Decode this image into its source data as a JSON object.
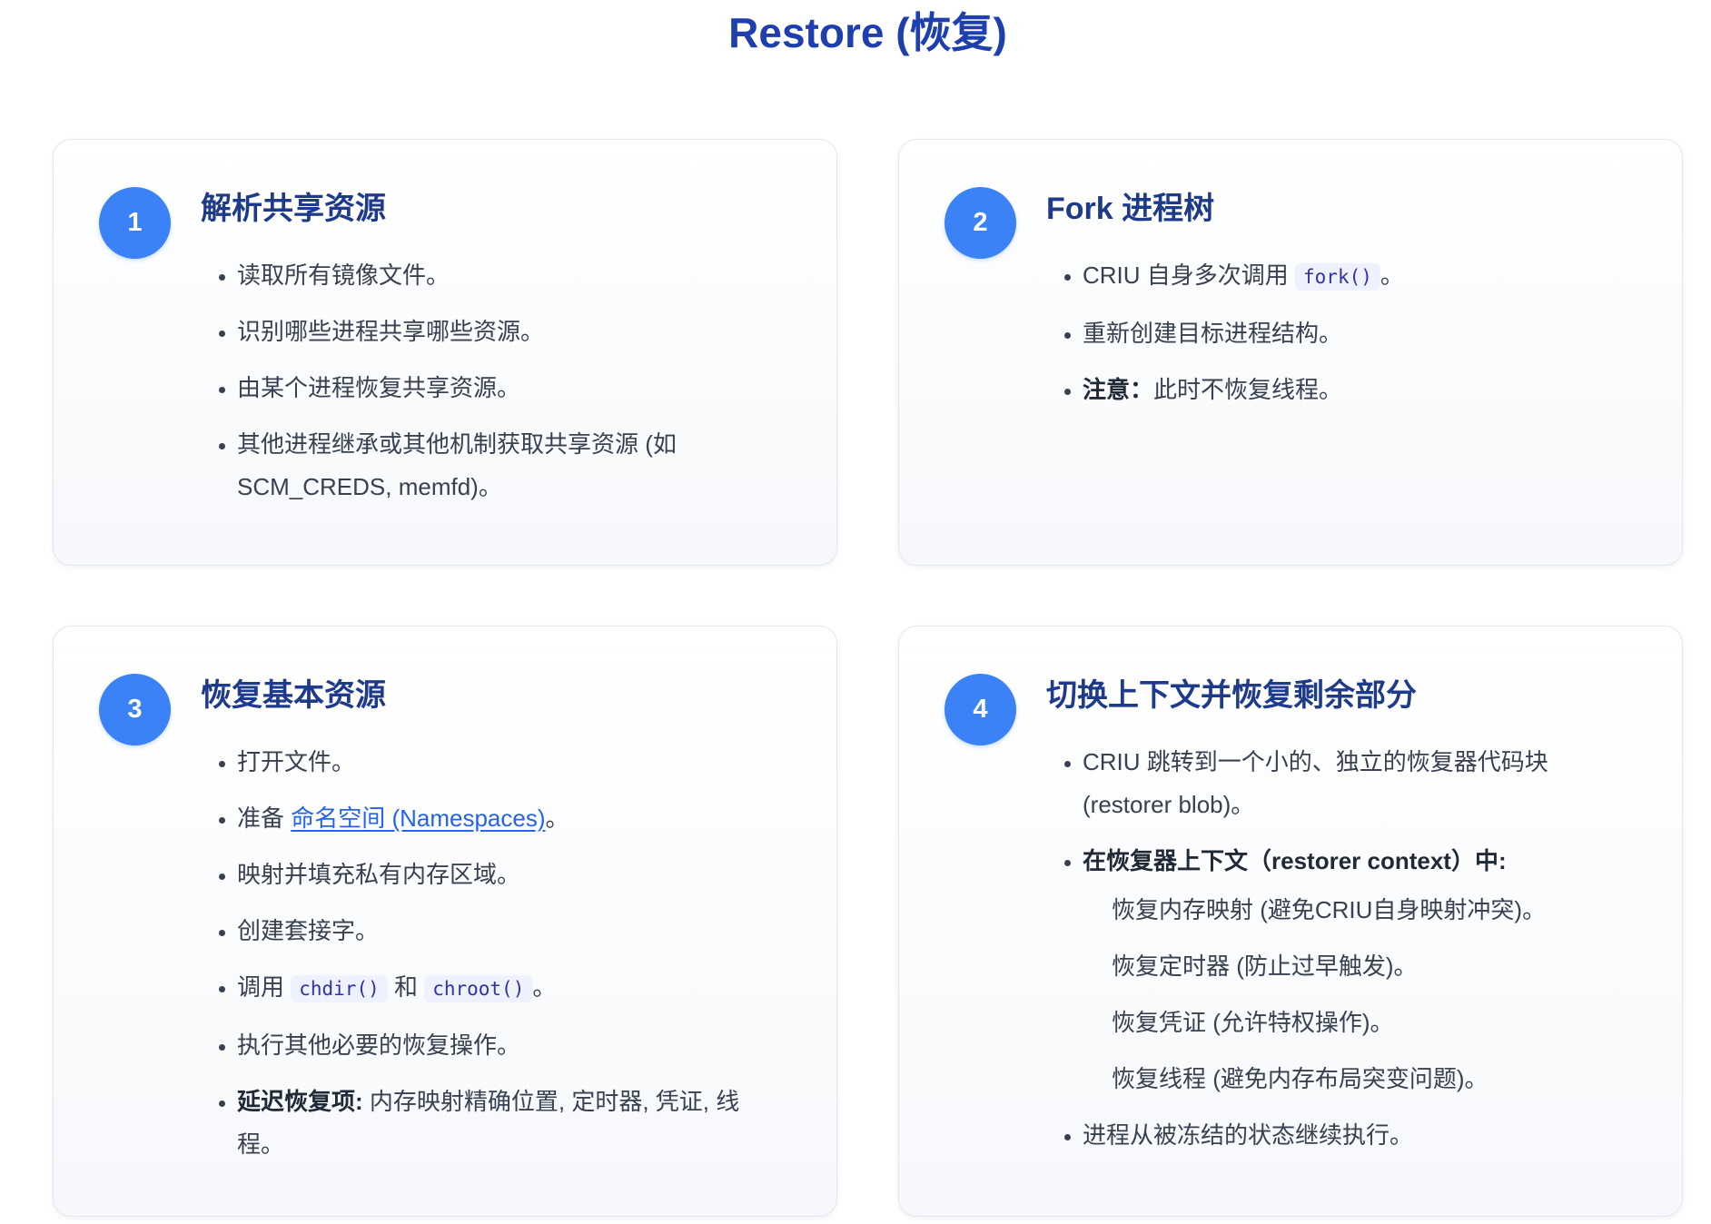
{
  "page": {
    "title": "Restore (恢复)"
  },
  "colors": {
    "title": "#1e40af",
    "heading": "#1e3a8a",
    "accent_badge": "#3b82f6",
    "body_text": "#374151",
    "link": "#2563eb",
    "code_background": "#eef2ff",
    "code_text": "#3730a3"
  },
  "steps": [
    {
      "number": "1",
      "heading": "解析共享资源",
      "items": [
        {
          "text": "读取所有镜像文件。"
        },
        {
          "text": "识别哪些进程共享哪些资源。"
        },
        {
          "text": "由某个进程恢复共享资源。"
        },
        {
          "text": "其他进程继承或其他机制获取共享资源 (如 SCM_CREDS, memfd)。"
        }
      ]
    },
    {
      "number": "2",
      "heading": "Fork 进程树",
      "items": [
        {
          "before": "CRIU 自身多次调用 ",
          "code": "fork()",
          "after": "。"
        },
        {
          "text": "重新创建目标进程结构。"
        },
        {
          "bold": "注意：",
          "text": "此时不恢复线程。"
        }
      ]
    },
    {
      "number": "3",
      "heading": "恢复基本资源",
      "items": [
        {
          "text": "打开文件。"
        },
        {
          "before": "准备 ",
          "link": "命名空间 (Namespaces)",
          "after": "。"
        },
        {
          "text": "映射并填充私有内存区域。"
        },
        {
          "text": "创建套接字。"
        },
        {
          "before": "调用 ",
          "code": "chdir()",
          "middle": " 和 ",
          "code2": "chroot()",
          "after": "。"
        },
        {
          "text": "执行其他必要的恢复操作。"
        },
        {
          "bold": "延迟恢复项:",
          "text": " 内存映射精确位置, 定时器, 凭证, 线程。"
        }
      ]
    },
    {
      "number": "4",
      "heading": "切换上下文并恢复剩余部分",
      "items": [
        {
          "text": "CRIU 跳转到一个小的、独立的恢复器代码块 (restorer blob)。"
        },
        {
          "bold": "在恢复器上下文（restorer context）中:",
          "subitems": [
            "恢复内存映射 (避免CRIU自身映射冲突)。",
            "恢复定时器 (防止过早触发)。",
            "恢复凭证 (允许特权操作)。",
            "恢复线程 (避免内存布局突变问题)。"
          ]
        },
        {
          "text": "进程从被冻结的状态继续执行。"
        }
      ]
    }
  ]
}
